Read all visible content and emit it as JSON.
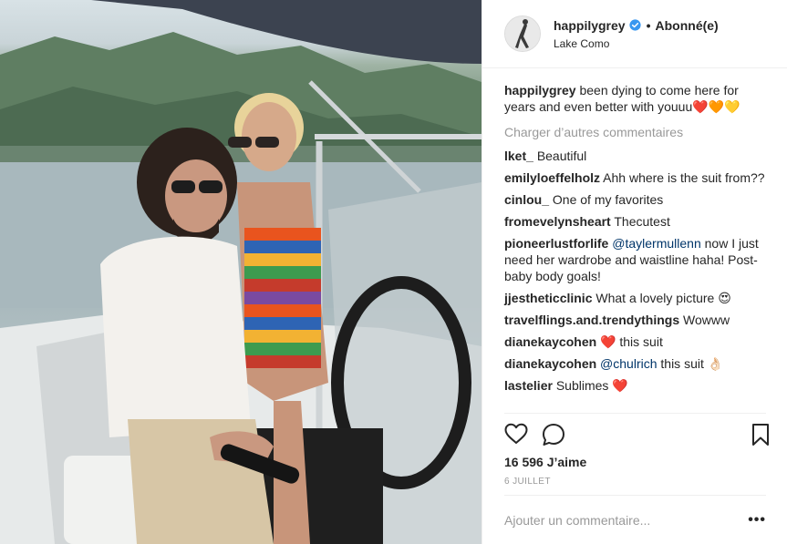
{
  "post": {
    "username": "happilygrey",
    "follow_status": "Abonné(e)",
    "location": "Lake Como",
    "separator": "•",
    "caption_user": "happilygrey",
    "caption_text": "been dying to come here for years and even better with youuu❤️🧡💛",
    "load_more": "Charger d’autres commentaires",
    "comments": [
      {
        "user": "lket_",
        "text": "Beautiful"
      },
      {
        "user": "emilyloeffelholz",
        "text": "Ahh where is the suit from??"
      },
      {
        "user": "cinlou_",
        "text": "One of my favorites"
      },
      {
        "user": "fromevelynsheart",
        "text": "Thecutest"
      },
      {
        "user": "pioneerlustforlife",
        "mention": "@taylermullenn",
        "text": "now I just need her wardrobe and waistline haha! Post-baby body goals!"
      },
      {
        "user": "jjestheticclinic",
        "text": "What a lovely picture 😍"
      },
      {
        "user": "travelflings.and.trendythings",
        "text": "Wowww"
      },
      {
        "user": "dianekaycohen",
        "text": "❤️ this suit"
      },
      {
        "user": "dianekaycohen",
        "mention": "@chulrich",
        "text": "this suit 👌🏻"
      },
      {
        "user": "lastelier",
        "text": "Sublimes ❤️"
      }
    ],
    "likes": "16 596 J’aime",
    "date": "6 JUILLET",
    "add_comment_placeholder": "Ajouter un commentaire...",
    "more_label": "•••"
  },
  "icons": {
    "like": "heart-outline-icon",
    "comment": "speech-bubble-icon",
    "save": "bookmark-icon",
    "verified": "verified-badge-icon"
  },
  "colors": {
    "text": "#262626",
    "muted": "#999999",
    "verified": "#3897f0",
    "mention": "#003569"
  }
}
